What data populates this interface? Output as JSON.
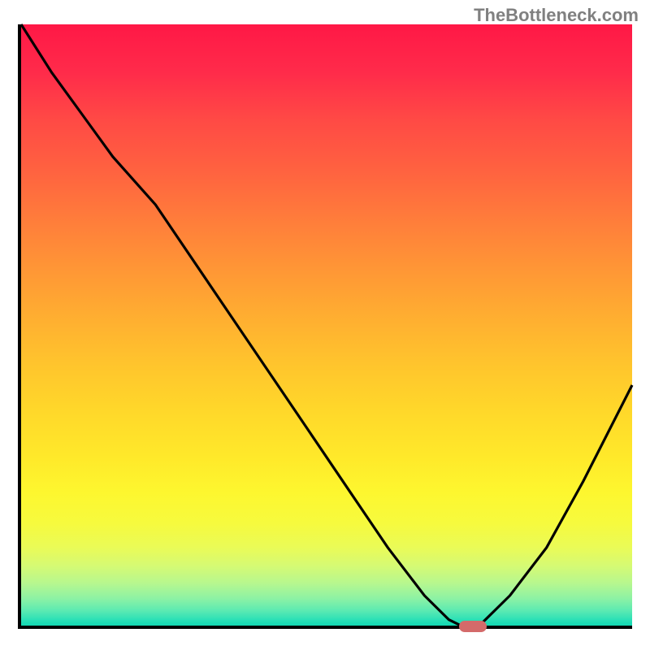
{
  "watermark": "TheBottleneck.com",
  "chart_data": {
    "type": "line",
    "title": "",
    "xlabel": "",
    "ylabel": "",
    "x": [
      0.0,
      0.05,
      0.1,
      0.15,
      0.22,
      0.3,
      0.38,
      0.46,
      0.54,
      0.6,
      0.66,
      0.7,
      0.72,
      0.75,
      0.8,
      0.86,
      0.92,
      1.0
    ],
    "values": [
      1.0,
      0.92,
      0.85,
      0.78,
      0.7,
      0.58,
      0.46,
      0.34,
      0.22,
      0.13,
      0.05,
      0.01,
      0.0,
      0.0,
      0.05,
      0.13,
      0.24,
      0.4
    ],
    "xlim": [
      0,
      1
    ],
    "ylim": [
      0,
      1
    ],
    "gradient": {
      "top_color": "#ff1846",
      "mid_color": "#ffd72a",
      "bottom_color": "#12d9b3"
    },
    "marker": {
      "x": 0.735,
      "y": 0.0,
      "color": "#d46a6a"
    }
  }
}
